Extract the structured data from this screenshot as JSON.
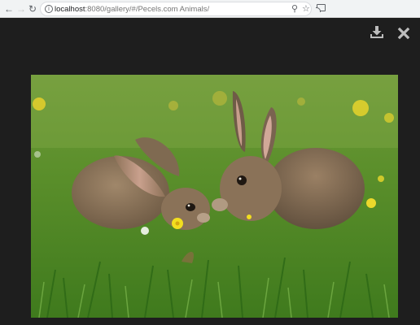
{
  "browser": {
    "url_host": "localhost",
    "url_path": ":8080/gallery/#/Pecels.com Animals/",
    "icons": {
      "back": "back-arrow-icon",
      "forward": "forward-arrow-icon",
      "reload": "reload-icon",
      "site_info": "info-icon",
      "zoom": "search-icon",
      "bookmark": "star-icon",
      "cast": "cast-icon"
    }
  },
  "viewer": {
    "icons": {
      "download": "download-icon",
      "close": "close-icon"
    },
    "image_subject": "two rabbits on grass"
  }
}
